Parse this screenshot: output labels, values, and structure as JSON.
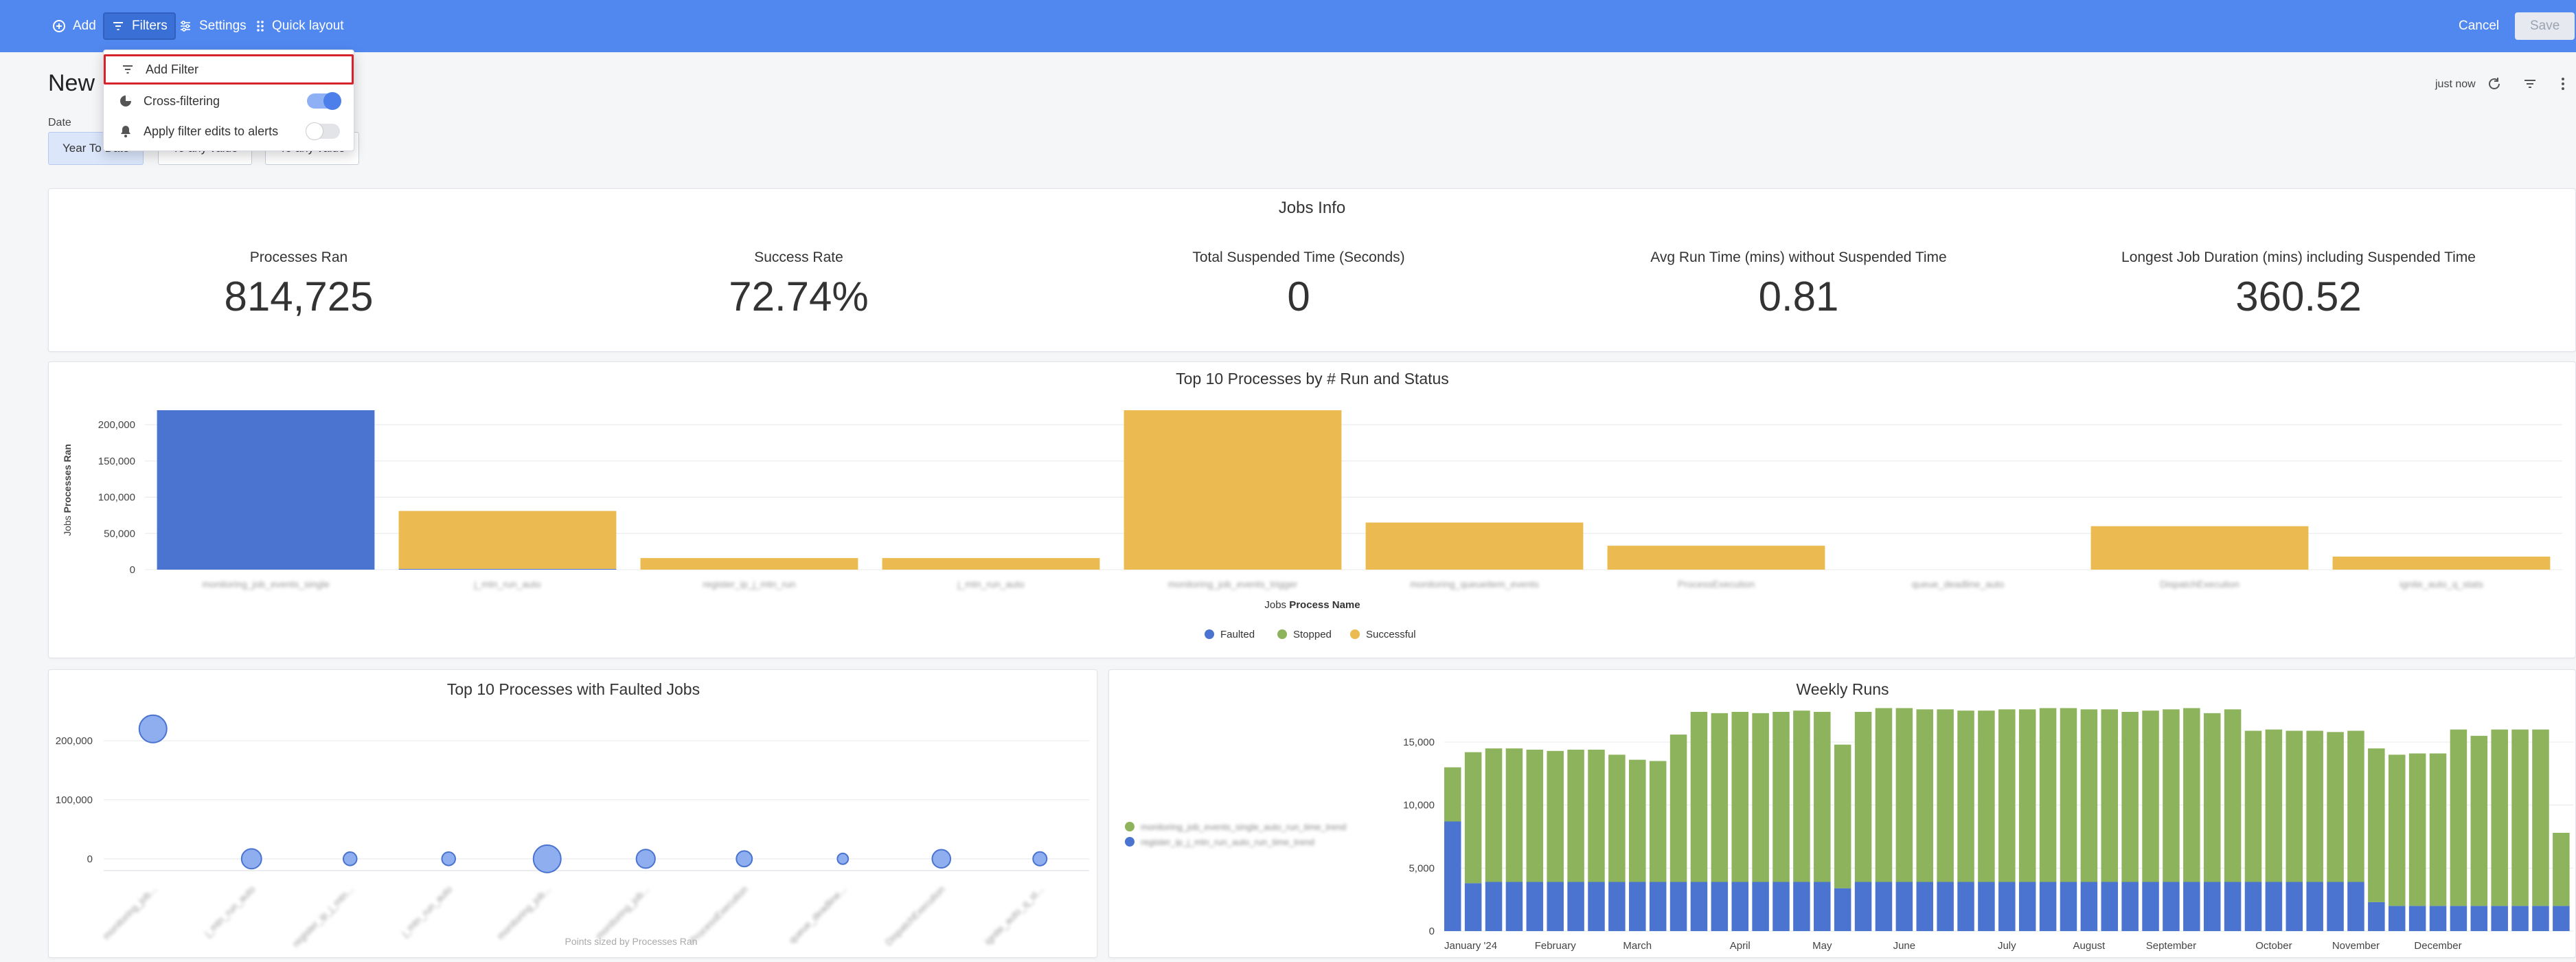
{
  "toolbar": {
    "add_label": "Add",
    "filters_label": "Filters",
    "settings_label": "Settings",
    "quick_layout_label": "Quick layout",
    "cancel_label": "Cancel",
    "save_label": "Save"
  },
  "filters_menu": {
    "add_filter": "Add Filter",
    "cross_filtering": "Cross-filtering",
    "cross_filtering_on": true,
    "apply_to_alerts": "Apply filter edits to alerts",
    "apply_to_alerts_on": false
  },
  "dashboard": {
    "title": "New D",
    "refresh_time": "just now"
  },
  "date_filter": {
    "label": "Date",
    "preset": "Year To Date",
    "from": "To any value",
    "to": "To any value"
  },
  "jobs_info": {
    "title": "Jobs Info",
    "kpis": [
      {
        "label": "Processes Ran",
        "value": "814,725"
      },
      {
        "label": "Success Rate",
        "value": "72.74%"
      },
      {
        "label": "Total Suspended Time (Seconds)",
        "value": "0"
      },
      {
        "label": "Avg Run Time (mins) without Suspended Time",
        "value": "0.81"
      },
      {
        "label": "Longest Job Duration (mins) including Suspended Time",
        "value": "360.52"
      }
    ]
  },
  "colors": {
    "faulted": "#4a74d0",
    "stopped": "#8db35c",
    "successful": "#ebbb52",
    "accent": "#5188f0",
    "bubble": "#8eaeef"
  },
  "chart_data": [
    {
      "type": "bar",
      "title": "Top 10 Processes by # Run and Status",
      "xlabel_prefix": "Jobs",
      "xlabel": "Process Name",
      "ylabel_prefix": "Jobs",
      "ylabel": "Processes Ran",
      "ylim": [
        0,
        220000
      ],
      "yticks": [
        "0",
        "50,000",
        "100,000",
        "150,000",
        "200,000"
      ],
      "ytick_values": [
        0,
        50000,
        100000,
        150000,
        200000
      ],
      "categories": [
        "monitoring_job_events_single",
        "j_mtn_run_auto",
        "register_ip_j_mtn_run",
        "j_mtn_run_auto",
        "monitoring_job_events_trigger",
        "monitoring_queueitem_events",
        "ProcessExecution",
        "queue_deadline_auto",
        "DispatchExecution",
        "ignite_auto_q_stats"
      ],
      "series": [
        {
          "name": "Faulted",
          "values": [
            220000,
            1000,
            0,
            0,
            0,
            0,
            0,
            0,
            0,
            0
          ]
        },
        {
          "name": "Stopped",
          "values": [
            0,
            0,
            0,
            0,
            0,
            0,
            0,
            0,
            0,
            0
          ]
        },
        {
          "name": "Successful",
          "values": [
            0,
            80000,
            16000,
            16000,
            220000,
            65000,
            33000,
            0,
            60000,
            18000
          ]
        }
      ],
      "legend": "bottom",
      "grid": true
    },
    {
      "type": "scatter",
      "title": "Top 10 Processes with Faulted Jobs",
      "footnote": "Points sized by Processes Ran",
      "ylim": [
        -20000,
        250000
      ],
      "yticks": [
        "0",
        "100,000",
        "200,000"
      ],
      "ytick_values": [
        0,
        100000,
        200000
      ],
      "categories": [
        "monitoring_job...",
        "j_mtn_run_auto",
        "register_ip_j_mtn...",
        "j_mtn_run_auto",
        "monitoring_job...",
        "monitoring_job...",
        "ProcessExecution",
        "queue_deadline...",
        "DispatchExecution",
        "ignite_auto_q_st..."
      ],
      "values": [
        220000,
        0,
        0,
        0,
        0,
        0,
        0,
        0,
        0,
        0
      ],
      "sizes": [
        220000,
        80000,
        16000,
        16000,
        220000,
        65000,
        33000,
        4000,
        60000,
        18000
      ],
      "grid": true
    },
    {
      "type": "bar",
      "stacked": true,
      "title": "Weekly Runs",
      "ylim": [
        0,
        18000
      ],
      "yticks": [
        "0",
        "5,000",
        "10,000",
        "15,000"
      ],
      "ytick_values": [
        0,
        5000,
        10000,
        15000
      ],
      "xtick_labels": [
        "January '24",
        "February",
        "March",
        "April",
        "May",
        "June",
        "July",
        "August",
        "September",
        "October",
        "November",
        "December"
      ],
      "xtick_indices": [
        0,
        5,
        9,
        14,
        18,
        22,
        27,
        31,
        35,
        40,
        44,
        48
      ],
      "legend_entries": [
        "monitoring_job_events_single_auto_run_time_trend",
        "register_ip_j_mtn_run_auto_run_time_trend"
      ],
      "series": [
        {
          "name": "Faulted",
          "values": [
            8700,
            3800,
            3900,
            3900,
            3900,
            3900,
            3900,
            3900,
            3900,
            3900,
            3900,
            3900,
            3900,
            3900,
            3900,
            3900,
            3900,
            3900,
            3900,
            3400,
            3900,
            3900,
            3900,
            3900,
            3900,
            3900,
            3900,
            3900,
            3900,
            3900,
            3900,
            3900,
            3900,
            3900,
            3900,
            3900,
            3900,
            3900,
            3900,
            3900,
            3900,
            3900,
            3900,
            3900,
            3900,
            2300,
            2000,
            2000,
            2000,
            2000,
            2000,
            2000,
            2000,
            2000,
            2000
          ]
        },
        {
          "name": "Stopped",
          "values": [
            4300,
            10400,
            10600,
            10600,
            10500,
            10400,
            10500,
            10500,
            10100,
            9700,
            9600,
            11700,
            13500,
            13400,
            13500,
            13400,
            13500,
            13600,
            13500,
            11400,
            13500,
            13800,
            13800,
            13700,
            13700,
            13600,
            13600,
            13700,
            13700,
            13800,
            13800,
            13700,
            13700,
            13500,
            13600,
            13700,
            13800,
            13400,
            13700,
            12000,
            12100,
            12000,
            12000,
            11900,
            12000,
            12200,
            12000,
            12100,
            12100,
            14000,
            13500,
            14000,
            14000,
            14000,
            5800
          ]
        }
      ],
      "grid": true
    }
  ]
}
